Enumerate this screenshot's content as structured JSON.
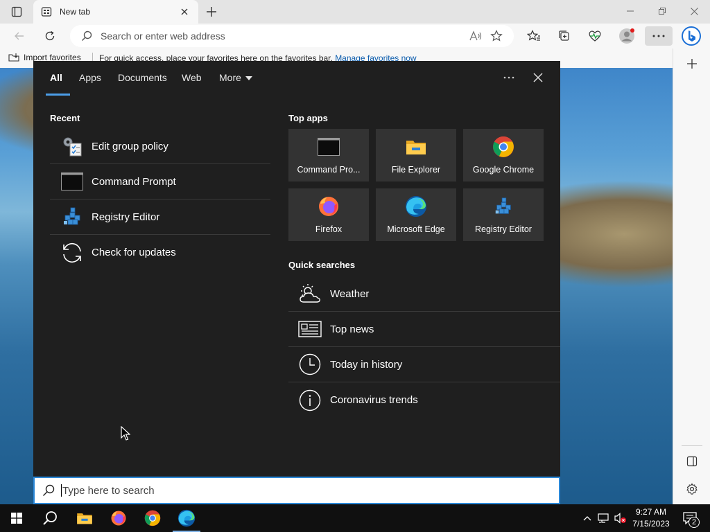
{
  "browser": {
    "tab_title": "New tab",
    "address_placeholder": "Search or enter web address",
    "favorites_bar": {
      "import_label": "Import favorites",
      "message": "For quick access, place your favorites here on the favorites bar.",
      "link": "Manage favorites now"
    }
  },
  "search_panel": {
    "tabs": [
      {
        "label": "All",
        "active": true
      },
      {
        "label": "Apps"
      },
      {
        "label": "Documents"
      },
      {
        "label": "Web"
      },
      {
        "label": "More"
      }
    ],
    "recent_title": "Recent",
    "recent": [
      {
        "label": "Edit group policy",
        "icon": "group-policy-icon"
      },
      {
        "label": "Command Prompt",
        "icon": "command-prompt-icon"
      },
      {
        "label": "Registry Editor",
        "icon": "registry-editor-icon"
      },
      {
        "label": "Check for updates",
        "icon": "refresh-icon"
      }
    ],
    "top_apps_title": "Top apps",
    "top_apps": [
      {
        "label": "Command Pro...",
        "icon": "command-prompt-icon"
      },
      {
        "label": "File Explorer",
        "icon": "folder-icon"
      },
      {
        "label": "Google Chrome",
        "icon": "chrome-icon"
      },
      {
        "label": "Firefox",
        "icon": "firefox-icon"
      },
      {
        "label": "Microsoft Edge",
        "icon": "edge-icon"
      },
      {
        "label": "Registry Editor",
        "icon": "registry-editor-icon"
      }
    ],
    "quick_searches_title": "Quick searches",
    "quick_searches": [
      {
        "label": "Weather",
        "icon": "weather-icon"
      },
      {
        "label": "Top news",
        "icon": "news-icon"
      },
      {
        "label": "Today in history",
        "icon": "clock-icon"
      },
      {
        "label": "Coronavirus trends",
        "icon": "info-icon"
      }
    ],
    "search_placeholder": "Type here to search"
  },
  "taskbar": {
    "time": "9:27 AM",
    "date": "7/15/2023",
    "notification_count": "2"
  },
  "colors": {
    "accent": "#2b88d8",
    "panel_bg": "#1f1f1f",
    "tile_bg": "#333333",
    "taskbar_bg": "#101010"
  }
}
